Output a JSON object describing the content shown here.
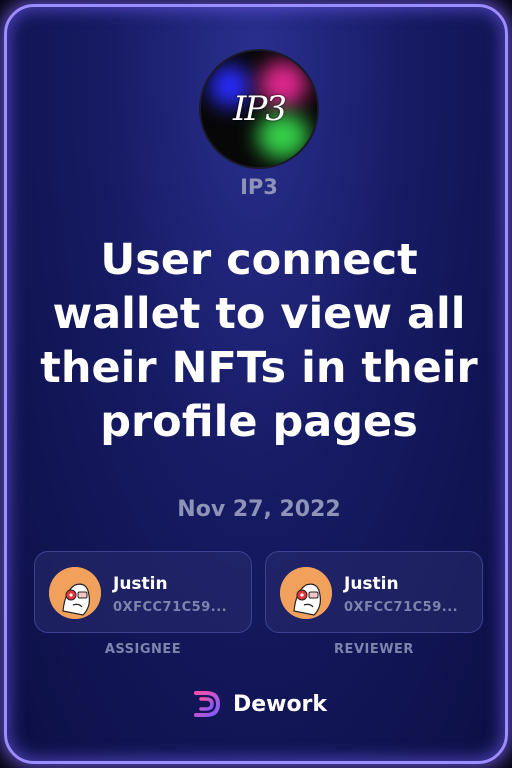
{
  "organization": {
    "logo_text": "IP3",
    "name": "IP3"
  },
  "task": {
    "title": "User connect wallet to view all their NFTs in their profile pages",
    "date": "Nov 27, 2022"
  },
  "assignee": {
    "name": "Justin",
    "address": "0XFCC71C59...",
    "role_label": "ASSIGNEE"
  },
  "reviewer": {
    "name": "Justin",
    "address": "0XFCC71C59...",
    "role_label": "REVIEWER"
  },
  "brand": {
    "name": "Dework",
    "icon": "dework-logo-icon"
  },
  "colors": {
    "card_border": "#9b8cff",
    "background": "#161a62",
    "muted_text": "#8e93b8",
    "avatar_bg": "#f2a15c"
  }
}
